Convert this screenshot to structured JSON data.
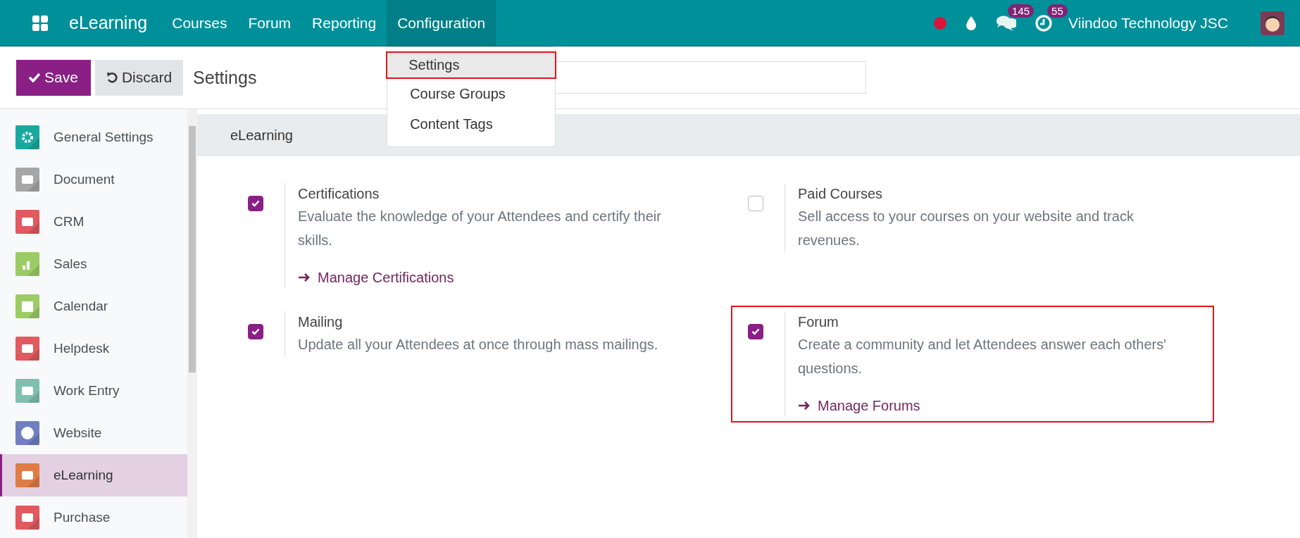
{
  "navbar": {
    "app_name": "eLearning",
    "menu": [
      {
        "label": "Courses",
        "selected": false
      },
      {
        "label": "Forum",
        "selected": false
      },
      {
        "label": "Reporting",
        "selected": false
      },
      {
        "label": "Configuration",
        "selected": true
      }
    ],
    "messages_count": "145",
    "activities_count": "55",
    "company": "Viindoo Technology JSC"
  },
  "dropdown": [
    {
      "label": "Settings",
      "highlighted": true
    },
    {
      "label": "Course Groups",
      "highlighted": false
    },
    {
      "label": "Content Tags",
      "highlighted": false
    }
  ],
  "control_panel": {
    "save": "Save",
    "discard": "Discard",
    "title": "Settings"
  },
  "sidebar": {
    "items": [
      {
        "label": "General Settings",
        "color": "#1aa9a0",
        "selected": false
      },
      {
        "label": "Document",
        "color": "#a6a6a6",
        "selected": false
      },
      {
        "label": "CRM",
        "color": "#e05a5f",
        "selected": false
      },
      {
        "label": "Sales",
        "color": "#9ccc65",
        "selected": false
      },
      {
        "label": "Calendar",
        "color": "#9ccc65",
        "selected": false
      },
      {
        "label": "Helpdesk",
        "color": "#e05a5f",
        "selected": false
      },
      {
        "label": "Work Entry",
        "color": "#80c0b0",
        "selected": false
      },
      {
        "label": "Website",
        "color": "#6f7fbf",
        "selected": false
      },
      {
        "label": "eLearning",
        "color": "#e07c45",
        "selected": true
      },
      {
        "label": "Purchase",
        "color": "#e05a5f",
        "selected": false
      }
    ]
  },
  "section": {
    "title": "eLearning",
    "settings": [
      {
        "title": "Certifications",
        "description": "Evaluate the knowledge of your Attendees and certify their skills.",
        "checked": true,
        "link": "Manage Certifications",
        "highlighted": false
      },
      {
        "title": "Paid Courses",
        "description": "Sell access to your courses on your website and track revenues.",
        "checked": false,
        "highlighted": false
      },
      {
        "title": "Mailing",
        "description": "Update all your Attendees at once through mass mailings.",
        "checked": true,
        "highlighted": false
      },
      {
        "title": "Forum",
        "description": "Create a community and let Attendees answer each others' questions.",
        "checked": true,
        "link": "Manage Forums",
        "highlighted": true
      }
    ]
  }
}
